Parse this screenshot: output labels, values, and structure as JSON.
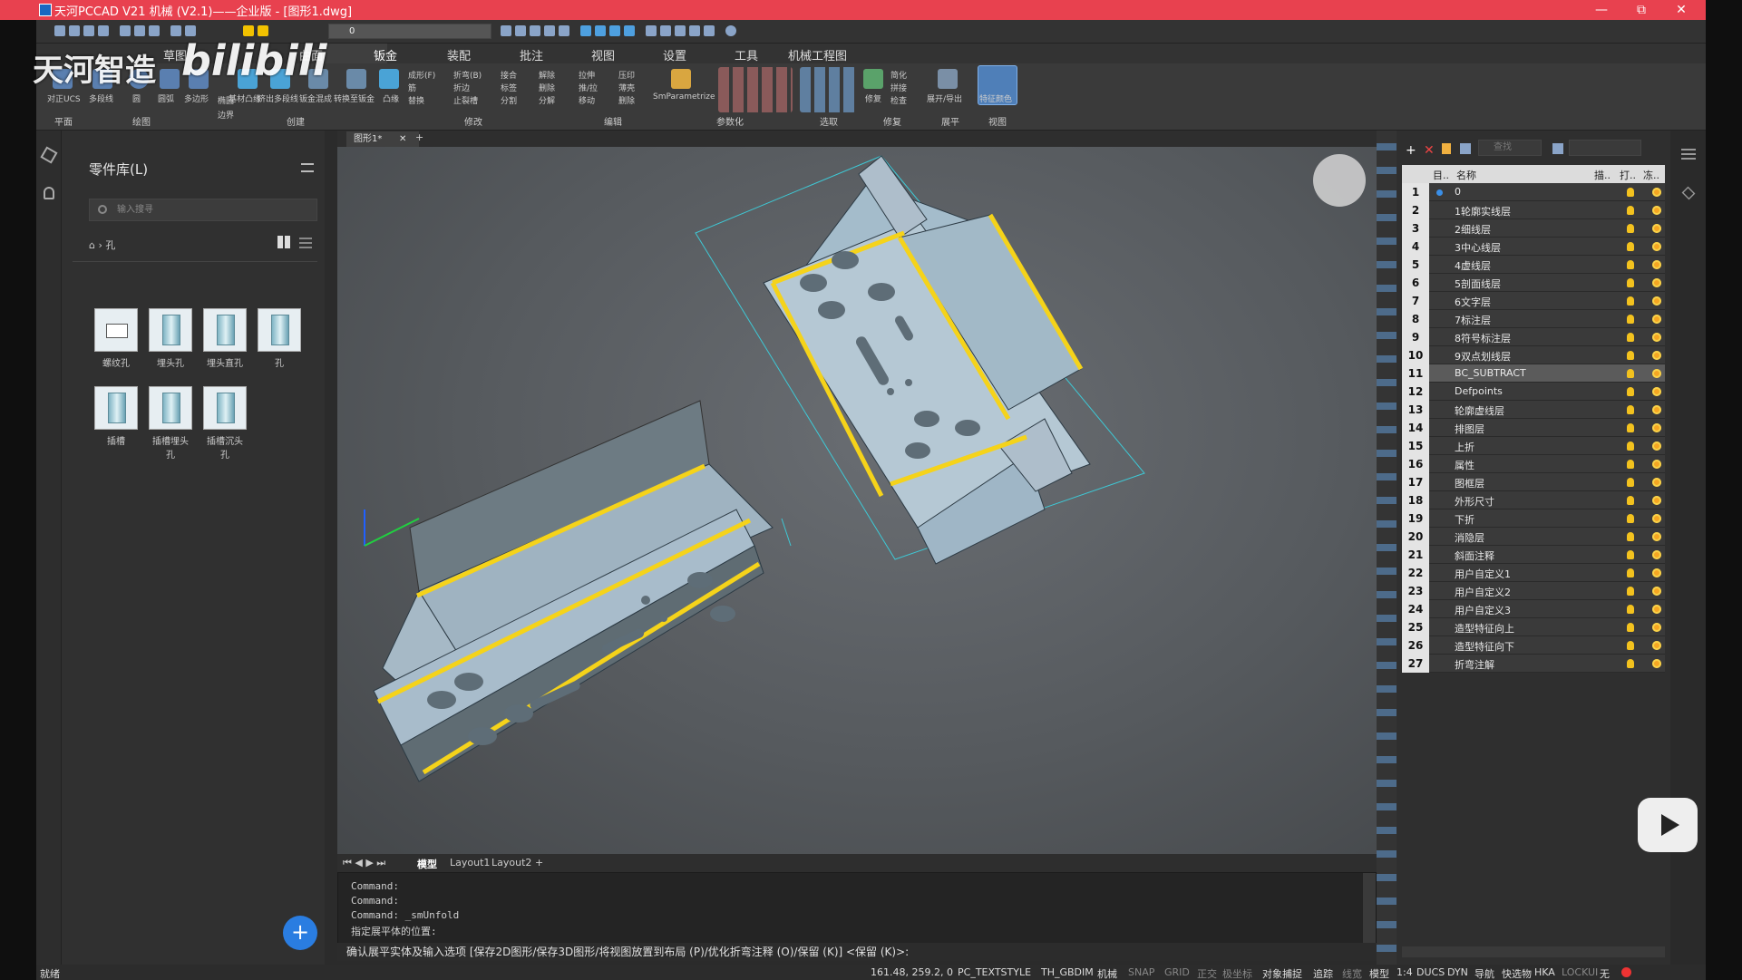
{
  "window": {
    "title": "天河PCCAD V21 机械 (V2.1)——企业版 - [图形1.dwg]",
    "min": "—",
    "max": "⧉",
    "close": "✕"
  },
  "quickbar": {
    "layer_value": "0"
  },
  "watermark": {
    "text1": "天河智造",
    "text2": "bilibili"
  },
  "menu_tabs": [
    "草图",
    "曲面",
    "钣金",
    "装配",
    "批注",
    "视图",
    "设置",
    "工具",
    "机械工程图"
  ],
  "menu_active": "钣金",
  "ribbon": {
    "groups": [
      "平面",
      "绘图",
      "创建",
      "修改",
      "编辑",
      "参数化",
      "选取",
      "修复",
      "展平",
      "视图"
    ],
    "buttons": [
      "对正UCS",
      "多段线",
      "圆",
      "圆弧",
      "多边形",
      "基材凸缘",
      "挤出多段线",
      "钣金混成",
      "转换至钣金",
      "凸缘",
      "SmParametrize",
      "修复",
      "展开/导出",
      "特征颜色"
    ],
    "small": {
      "col1": [
        "成形(F)",
        "筋",
        "替换"
      ],
      "col2": [
        "折弯(B)",
        "折边",
        "止裂槽"
      ],
      "col3": [
        "接合",
        "标签",
        "分割"
      ],
      "col4": [
        "解除",
        "删除",
        "分解"
      ],
      "col5": [
        "拉伸",
        "推/拉",
        "移动"
      ],
      "col6": [
        "压印",
        "薄壳",
        "删除"
      ],
      "col7": [
        "简化",
        "拼接",
        "检查"
      ],
      "col8": [
        "椭圆",
        "边界"
      ]
    }
  },
  "left_panel": {
    "title": "零件库(L)",
    "search_placeholder": "输入搜寻",
    "breadcrumb": "孔",
    "parts": [
      {
        "label": "螺纹孔"
      },
      {
        "label": "埋头孔"
      },
      {
        "label": "埋头直孔"
      },
      {
        "label": "孔"
      },
      {
        "label": "插槽"
      },
      {
        "label": "插槽埋头孔"
      },
      {
        "label": "插槽沉头孔"
      }
    ],
    "add_button": "+"
  },
  "doc_tab": {
    "name": "图形1*",
    "close": "✕",
    "add": "+"
  },
  "layout_tabs": {
    "model": "模型",
    "layout1": "Layout1",
    "layout2": "Layout2",
    "add": "+"
  },
  "command_history": [
    "Command:",
    "Command:",
    "Command:  _smUnfold",
    "指定展平体的位置:"
  ],
  "command_prompt": "确认展平实体及输入选项 [保存2D图形/保存3D图形/将视图放置到布局 (P)/优化折弯注释 (O)/保留 (K)] <保留 (K)>:",
  "layer_panel": {
    "filter_placeholder": "查找",
    "headers": {
      "num": "目..",
      "name": "名称",
      "plot": "描..",
      "print": "打..",
      "freeze": "冻.."
    },
    "selected_index": 11,
    "layers": [
      {
        "num": "1",
        "name": "0"
      },
      {
        "num": "2",
        "name": "1轮廓实线层"
      },
      {
        "num": "3",
        "name": "2细线层"
      },
      {
        "num": "4",
        "name": "3中心线层"
      },
      {
        "num": "5",
        "name": "4虚线层"
      },
      {
        "num": "6",
        "name": "5剖面线层"
      },
      {
        "num": "7",
        "name": "6文字层"
      },
      {
        "num": "8",
        "name": "7标注层"
      },
      {
        "num": "9",
        "name": "8符号标注层"
      },
      {
        "num": "10",
        "name": "9双点划线层"
      },
      {
        "num": "11",
        "name": "BC_SUBTRACT"
      },
      {
        "num": "12",
        "name": "Defpoints"
      },
      {
        "num": "13",
        "name": "轮廓虚线层"
      },
      {
        "num": "14",
        "name": "排图层"
      },
      {
        "num": "15",
        "name": "上折"
      },
      {
        "num": "16",
        "name": "属性"
      },
      {
        "num": "17",
        "name": "图框层"
      },
      {
        "num": "18",
        "name": "外形尺寸"
      },
      {
        "num": "19",
        "name": "下折"
      },
      {
        "num": "20",
        "name": "消隐层"
      },
      {
        "num": "21",
        "name": "斜面注释"
      },
      {
        "num": "22",
        "name": "用户自定义1"
      },
      {
        "num": "23",
        "name": "用户自定义2"
      },
      {
        "num": "24",
        "name": "用户自定义3"
      },
      {
        "num": "25",
        "name": "造型特征向上"
      },
      {
        "num": "26",
        "name": "造型特征向下"
      },
      {
        "num": "27",
        "name": "折弯注解"
      }
    ]
  },
  "status": {
    "left": "就绪",
    "coords": "161.48, 259.2, 0",
    "textstyle": "PC_TEXTSTYLE",
    "dimstyle": "TH_GBDIM",
    "mode": "机械",
    "toggles": [
      "SNAP",
      "GRID",
      "正交",
      "极坐标",
      "对象捕捉",
      "追踪",
      "线宽",
      "模型",
      "1:4",
      "DUCS",
      "DYN",
      "导航",
      "快选物",
      "HKA",
      "LOCKUI",
      "无"
    ]
  },
  "colors": {
    "titlebar": "#e8414f",
    "accent": "#2a7de1",
    "bend_line": "#f5d31a",
    "sheet": "#9fb6c6"
  }
}
